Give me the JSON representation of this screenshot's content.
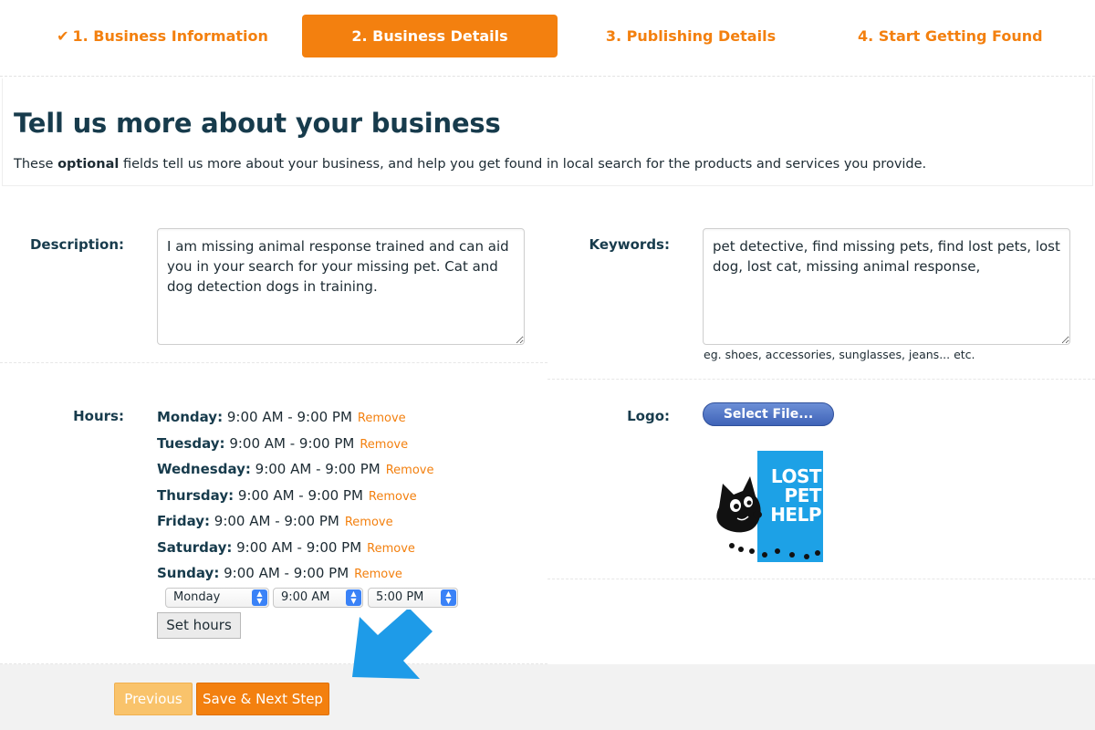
{
  "steps": [
    {
      "label": "1. Business Information",
      "completed": true,
      "icon": "checkmark-icon"
    },
    {
      "label": "2. Business Details",
      "active": true
    },
    {
      "label": "3. Publishing Details"
    },
    {
      "label": "4. Start Getting Found"
    }
  ],
  "intro": {
    "title": "Tell us more about your business",
    "text_before": "These ",
    "text_bold": "optional",
    "text_after": " fields tell us more about your business, and help you get found in local search for the products and services you provide."
  },
  "description": {
    "label": "Description:",
    "value": "I am missing animal response trained and can aid you in your search for your missing pet. Cat and dog detection dogs in training."
  },
  "keywords": {
    "label": "Keywords:",
    "value": "pet detective, find missing pets, find lost pets, lost dog, lost cat, missing animal response,",
    "hint": "eg. shoes, accessories, sunglasses, jeans... etc."
  },
  "hours": {
    "label": "Hours:",
    "remove_label": "Remove",
    "rows": [
      {
        "day": "Monday:",
        "time": " 9:00 AM - 9:00 PM"
      },
      {
        "day": "Tuesday:",
        "time": " 9:00 AM - 9:00 PM"
      },
      {
        "day": "Wednesday:",
        "time": " 9:00 AM - 9:00 PM"
      },
      {
        "day": "Thursday:",
        "time": " 9:00 AM - 9:00 PM"
      },
      {
        "day": "Friday:",
        "time": " 9:00 AM - 9:00 PM"
      },
      {
        "day": "Saturday:",
        "time": " 9:00 AM - 9:00 PM"
      },
      {
        "day": "Sunday:",
        "time": " 9:00 AM - 9:00 PM"
      }
    ],
    "day_select": "Monday",
    "open_select": "9:00 AM",
    "close_select": "5:00 PM",
    "set_button": "Set hours"
  },
  "logo": {
    "label": "Logo:",
    "select_button": "Select File...",
    "image_text": [
      "LOST",
      "PET",
      "HELP"
    ],
    "image_bg_color": "#1da1e6"
  },
  "footer": {
    "previous_label": "Previous",
    "next_label": "Save & Next Step"
  },
  "colors": {
    "accent": "#f3800f",
    "heading": "#173b4c",
    "arrow": "#1e9be8"
  }
}
